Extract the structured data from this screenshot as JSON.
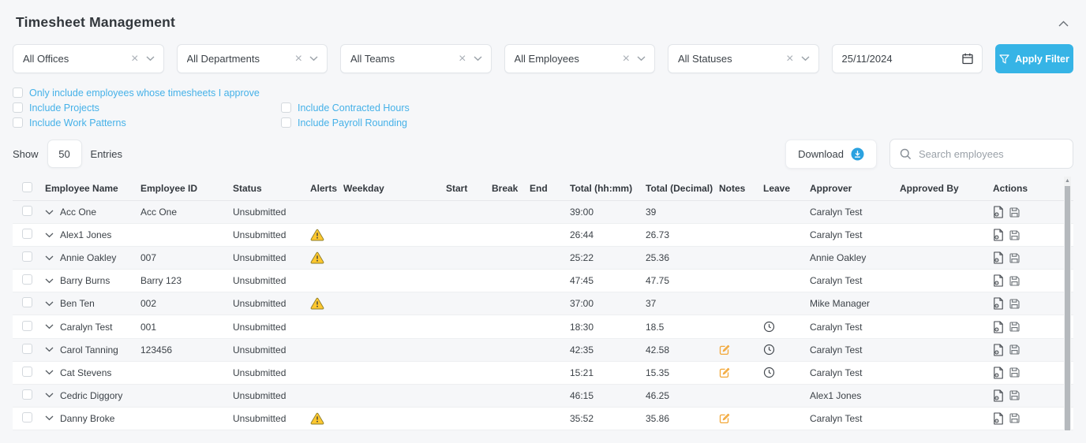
{
  "page": {
    "title": "Timesheet Management"
  },
  "filters": {
    "selects": [
      {
        "id": "offices",
        "value": "All Offices"
      },
      {
        "id": "departments",
        "value": "All Departments"
      },
      {
        "id": "teams",
        "value": "All Teams"
      },
      {
        "id": "employees",
        "value": "All Employees"
      },
      {
        "id": "statuses",
        "value": "All Statuses"
      }
    ],
    "date_value": "25/11/2024",
    "apply_button_label": "Apply Filter"
  },
  "options": {
    "approve_only": "Only include employees whose timesheets I approve",
    "include_projects": "Include Projects",
    "include_work_patterns": "Include Work Patterns",
    "include_contracted_hours": "Include Contracted Hours",
    "include_payroll_rounding": "Include Payroll Rounding"
  },
  "toolbar": {
    "show_label": "Show",
    "entries_value": "50",
    "entries_label": "Entries",
    "download_label": "Download",
    "search_placeholder": "Search employees"
  },
  "table": {
    "columns": [
      "Employee Name",
      "Employee ID",
      "Status",
      "Alerts",
      "Weekday",
      "Start",
      "Break",
      "End",
      "Total (hh:mm)",
      "Total (Decimal)",
      "Notes",
      "Leave",
      "Approver",
      "Approved By",
      "Actions"
    ],
    "rows": [
      {
        "name": "Acc One",
        "id": "Acc One",
        "status": "Unsubmitted",
        "alert": false,
        "weekday": "",
        "start": "",
        "break": "",
        "end": "",
        "total_hhmm": "39:00",
        "total_decimal": "39",
        "note": false,
        "leave": false,
        "approver": "Caralyn Test",
        "approved_by": ""
      },
      {
        "name": "Alex1 Jones",
        "id": "",
        "status": "Unsubmitted",
        "alert": true,
        "weekday": "",
        "start": "",
        "break": "",
        "end": "",
        "total_hhmm": "26:44",
        "total_decimal": "26.73",
        "note": false,
        "leave": false,
        "approver": "Caralyn Test",
        "approved_by": ""
      },
      {
        "name": "Annie Oakley",
        "id": "007",
        "status": "Unsubmitted",
        "alert": true,
        "weekday": "",
        "start": "",
        "break": "",
        "end": "",
        "total_hhmm": "25:22",
        "total_decimal": "25.36",
        "note": false,
        "leave": false,
        "approver": "Annie Oakley",
        "approved_by": ""
      },
      {
        "name": "Barry Burns",
        "id": "Barry 123",
        "status": "Unsubmitted",
        "alert": false,
        "weekday": "",
        "start": "",
        "break": "",
        "end": "",
        "total_hhmm": "47:45",
        "total_decimal": "47.75",
        "note": false,
        "leave": false,
        "approver": "Caralyn Test",
        "approved_by": ""
      },
      {
        "name": "Ben Ten",
        "id": "002",
        "status": "Unsubmitted",
        "alert": true,
        "weekday": "",
        "start": "",
        "break": "",
        "end": "",
        "total_hhmm": "37:00",
        "total_decimal": "37",
        "note": false,
        "leave": false,
        "approver": "Mike Manager",
        "approved_by": ""
      },
      {
        "name": "Caralyn Test",
        "id": "001",
        "status": "Unsubmitted",
        "alert": false,
        "weekday": "",
        "start": "",
        "break": "",
        "end": "",
        "total_hhmm": "18:30",
        "total_decimal": "18.5",
        "note": false,
        "leave": true,
        "approver": "Caralyn Test",
        "approved_by": ""
      },
      {
        "name": "Carol Tanning",
        "id": "123456",
        "status": "Unsubmitted",
        "alert": false,
        "weekday": "",
        "start": "",
        "break": "",
        "end": "",
        "total_hhmm": "42:35",
        "total_decimal": "42.58",
        "note": true,
        "leave": true,
        "approver": "Caralyn Test",
        "approved_by": ""
      },
      {
        "name": "Cat Stevens",
        "id": "",
        "status": "Unsubmitted",
        "alert": false,
        "weekday": "",
        "start": "",
        "break": "",
        "end": "",
        "total_hhmm": "15:21",
        "total_decimal": "15.35",
        "note": true,
        "leave": true,
        "approver": "Caralyn Test",
        "approved_by": ""
      },
      {
        "name": "Cedric Diggory",
        "id": "",
        "status": "Unsubmitted",
        "alert": false,
        "weekday": "",
        "start": "",
        "break": "",
        "end": "",
        "total_hhmm": "46:15",
        "total_decimal": "46.25",
        "note": false,
        "leave": false,
        "approver": "Alex1 Jones",
        "approved_by": ""
      },
      {
        "name": "Danny Broke",
        "id": "",
        "status": "Unsubmitted",
        "alert": true,
        "weekday": "",
        "start": "",
        "break": "",
        "end": "",
        "total_hhmm": "35:52",
        "total_decimal": "35.86",
        "note": true,
        "leave": false,
        "approver": "Caralyn Test",
        "approved_by": ""
      }
    ]
  },
  "icons": {
    "collapse": "chevron-up",
    "select_clear": "x-mark",
    "select_open": "chevron-down",
    "date": "calendar-icon",
    "apply": "funnel-icon",
    "download": "circle-down-arrow-icon",
    "search": "magnifier-icon",
    "alert": "warning-triangle-icon",
    "note": "edit-pencil-icon",
    "leave": "clock-icon",
    "action_view": "document-view-icon",
    "action_save": "floppy-disk-icon"
  },
  "colors": {
    "accent_blue": "#41b0e8",
    "button_blue": "#36b4e6",
    "alert_yellow": "#ffc72e",
    "note_orange": "#f2a738",
    "page_bg": "#f6f7f9",
    "text_dark": "#3c4248"
  }
}
